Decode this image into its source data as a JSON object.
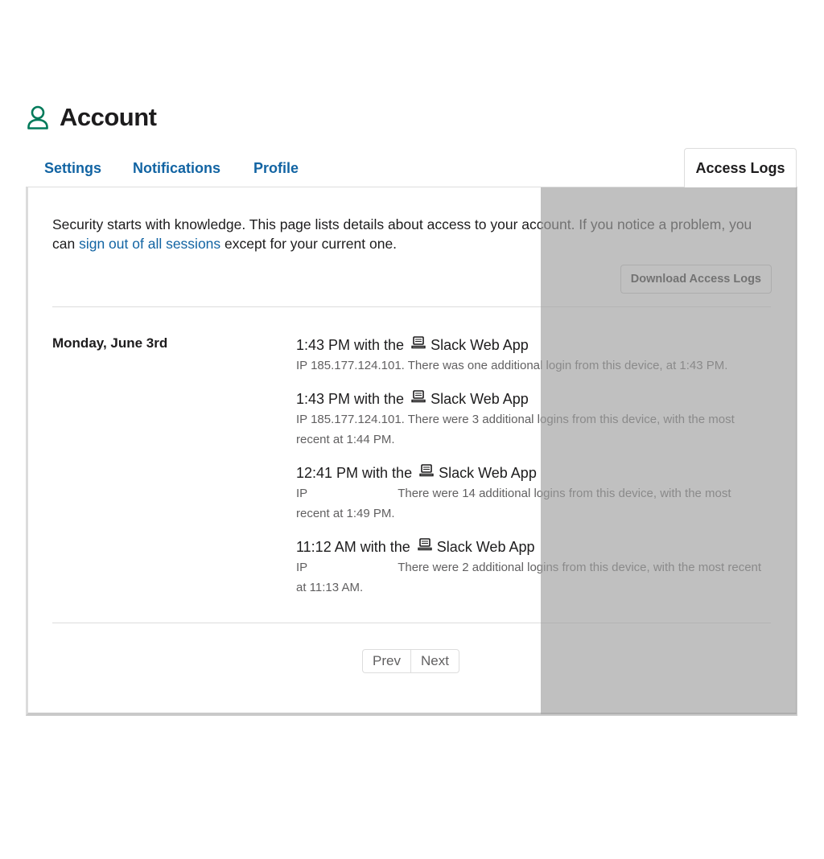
{
  "header": {
    "title": "Account",
    "icon": "user-icon",
    "accent_color": "#007a5a"
  },
  "tabs": [
    {
      "label": "Settings"
    },
    {
      "label": "Notifications"
    },
    {
      "label": "Profile"
    },
    {
      "label": "Access Logs",
      "active": true
    }
  ],
  "intro": {
    "text_before": "Security starts with knowledge. This page lists details about access to your account. If you notice a problem, you can",
    "link": "sign out of all sessions",
    "text_after": "except for your current one."
  },
  "download_button": "Download Access Logs",
  "log": {
    "date": "Monday, June 3rd",
    "entries": [
      {
        "time_prefix": "1:43 PM with the",
        "device_icon": "laptop-icon",
        "app": "Slack Web App",
        "detail": "IP 185.177.124.101. There was one additional login from this device, at 1:43 PM."
      },
      {
        "time_prefix": "1:43 PM with the",
        "device_icon": "laptop-icon",
        "app": "Slack Web App",
        "detail": "IP 185.177.124.101. There were 3 additional logins from this device, with the most recent at 1:44 PM."
      },
      {
        "time_prefix": "12:41 PM with the",
        "device_icon": "laptop-icon",
        "app": "Slack Web App",
        "ip_prefix": "IP",
        "detail": "There were 14 additional logins from this device, with the most recent at 1:49 PM."
      },
      {
        "time_prefix": "11:12 AM with the",
        "device_icon": "laptop-icon",
        "app": "Slack Web App",
        "ip_prefix": "IP",
        "detail": "There were 2 additional logins from this device, with the most recent at 11:13 AM."
      }
    ]
  },
  "pagination": {
    "prev": "Prev",
    "next": "Next"
  },
  "colors": {
    "link": "#1264a3",
    "text": "#1d1c1d",
    "muted": "#616061",
    "overlay": "#bebebe"
  }
}
